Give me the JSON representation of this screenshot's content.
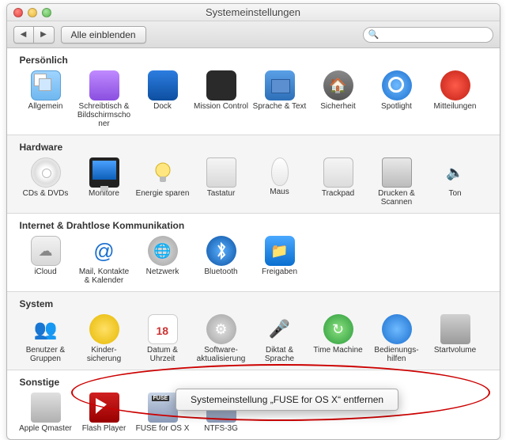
{
  "window": {
    "title": "Systemeinstellungen"
  },
  "toolbar": {
    "show_all": "Alle einblenden",
    "search_placeholder": ""
  },
  "sections": {
    "personal": {
      "title": "Persönlich",
      "items": [
        "Allgemein",
        "Schreibtisch & Bildschirmschoner",
        "Dock",
        "Mission Control",
        "Sprache & Text",
        "Sicherheit",
        "Spotlight",
        "Mitteilungen"
      ]
    },
    "hardware": {
      "title": "Hardware",
      "items": [
        "CDs & DVDs",
        "Monitore",
        "Energie sparen",
        "Tastatur",
        "Maus",
        "Trackpad",
        "Drucken & Scannen",
        "Ton"
      ]
    },
    "internet": {
      "title": "Internet & Drahtlose Kommunikation",
      "items": [
        "iCloud",
        "Mail, Kontakte & Kalender",
        "Netzwerk",
        "Bluetooth",
        "Freigaben"
      ]
    },
    "system": {
      "title": "System",
      "items": [
        "Benutzer & Gruppen",
        "Kinder-sicherung",
        "Datum & Uhrzeit",
        "Software-aktualisierung",
        "Diktat & Sprache",
        "Time Machine",
        "Bedienungs-hilfen",
        "Startvolume"
      ]
    },
    "other": {
      "title": "Sonstige",
      "items": [
        "Apple Qmaster",
        "Flash Player",
        "FUSE for OS X",
        "NTFS-3G"
      ]
    }
  },
  "context_menu": {
    "label": "Systemeinstellung „FUSE for OS X“ entfernen"
  }
}
